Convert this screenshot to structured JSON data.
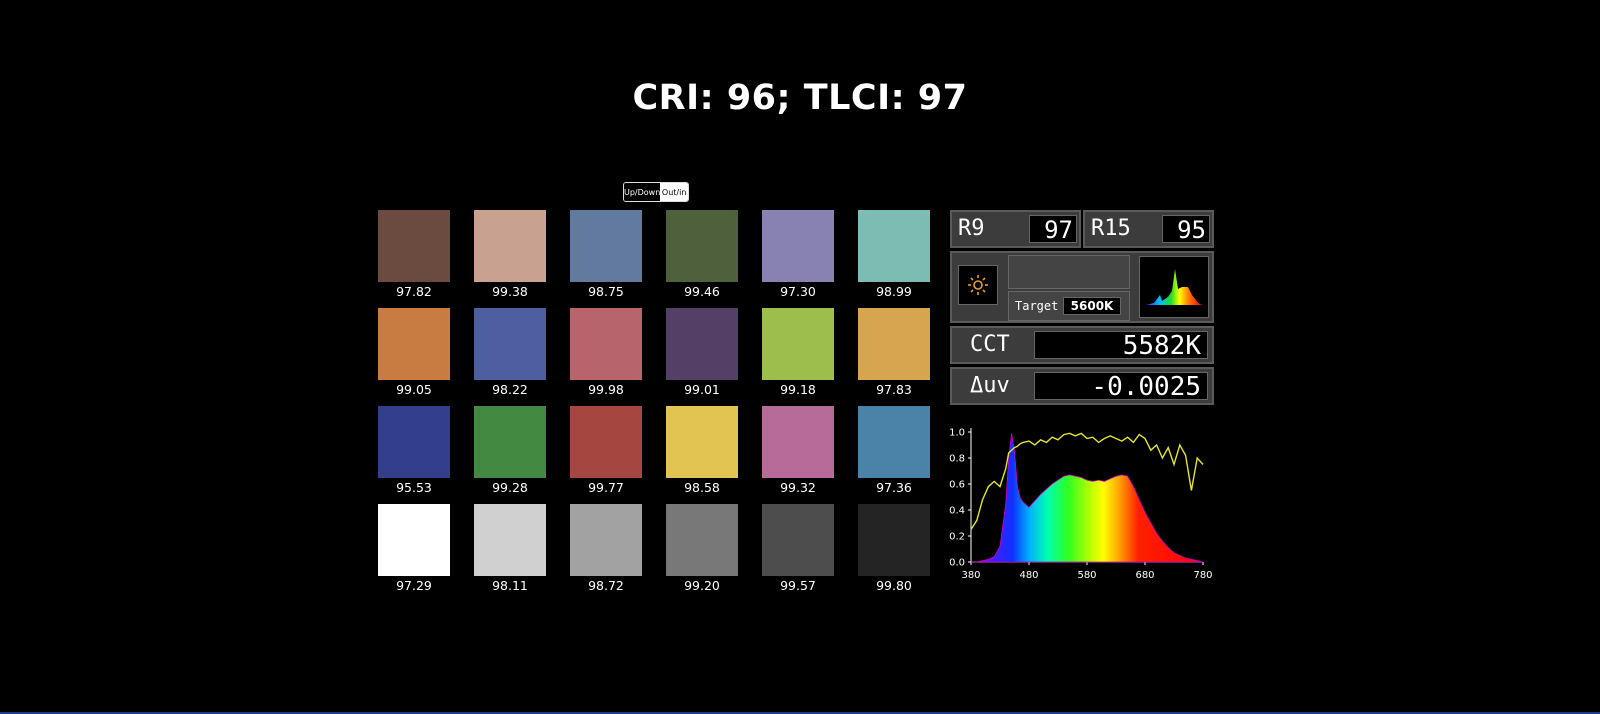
{
  "title": "CRI: 96; TLCI: 97",
  "toggle": {
    "left_label": "Up/Down",
    "right_label": "Out/in"
  },
  "swatches": [
    {
      "color": "#6b4a40",
      "value": "97.82"
    },
    {
      "color": "#c9a190",
      "value": "99.38"
    },
    {
      "color": "#627a9d",
      "value": "98.75"
    },
    {
      "color": "#4f613c",
      "value": "99.46"
    },
    {
      "color": "#8882b2",
      "value": "97.30"
    },
    {
      "color": "#7bbdb2",
      "value": "98.99"
    },
    {
      "color": "#c97c42",
      "value": "99.05"
    },
    {
      "color": "#4d5ea1",
      "value": "98.22"
    },
    {
      "color": "#b8646c",
      "value": "99.98"
    },
    {
      "color": "#543f66",
      "value": "99.01"
    },
    {
      "color": "#9dbd4d",
      "value": "99.18"
    },
    {
      "color": "#d6a550",
      "value": "97.83"
    },
    {
      "color": "#343f8b",
      "value": "95.53"
    },
    {
      "color": "#448941",
      "value": "99.28"
    },
    {
      "color": "#a54640",
      "value": "99.77"
    },
    {
      "color": "#e2c453",
      "value": "98.58"
    },
    {
      "color": "#b66b99",
      "value": "99.32"
    },
    {
      "color": "#4983a8",
      "value": "97.36"
    },
    {
      "color": "#ffffff",
      "value": "97.29"
    },
    {
      "color": "#d0d0d0",
      "value": "98.11"
    },
    {
      "color": "#a2a2a2",
      "value": "98.72"
    },
    {
      "color": "#787878",
      "value": "99.20"
    },
    {
      "color": "#4d4d4d",
      "value": "99.57"
    },
    {
      "color": "#242424",
      "value": "99.80"
    }
  ],
  "meter": {
    "r9_label": "R9",
    "r9_value": "97",
    "r15_label": "R15",
    "r15_value": "95",
    "target_label": "Target",
    "target_value": "5600K",
    "cct_label": "CCT",
    "cct_value": "5582K",
    "duv_label": "Δuv",
    "duv_value": "-0.0025",
    "sun_icon_color": "#e8a020"
  },
  "chart_data": {
    "type": "area",
    "x": [
      380,
      390,
      400,
      410,
      420,
      430,
      440,
      445,
      450,
      455,
      460,
      465,
      470,
      480,
      490,
      500,
      510,
      520,
      530,
      540,
      550,
      560,
      570,
      580,
      590,
      600,
      610,
      620,
      630,
      640,
      650,
      660,
      670,
      680,
      690,
      700,
      710,
      720,
      730,
      740,
      750,
      760,
      770,
      780
    ],
    "series": [
      {
        "values": [
          0.0,
          0.0,
          0.01,
          0.02,
          0.04,
          0.12,
          0.45,
          0.8,
          0.99,
          0.85,
          0.58,
          0.49,
          0.46,
          0.42,
          0.47,
          0.52,
          0.56,
          0.6,
          0.63,
          0.66,
          0.67,
          0.66,
          0.65,
          0.63,
          0.62,
          0.63,
          0.62,
          0.64,
          0.66,
          0.67,
          0.66,
          0.58,
          0.48,
          0.38,
          0.3,
          0.22,
          0.16,
          0.11,
          0.07,
          0.05,
          0.03,
          0.02,
          0.01,
          0.0
        ]
      },
      {
        "values": [
          0.25,
          0.32,
          0.48,
          0.58,
          0.62,
          0.58,
          0.72,
          0.84,
          0.86,
          0.88,
          0.89,
          0.91,
          0.92,
          0.93,
          0.9,
          0.94,
          0.92,
          0.96,
          0.94,
          0.98,
          0.99,
          0.97,
          0.99,
          0.95,
          0.96,
          0.92,
          0.95,
          0.97,
          0.95,
          0.93,
          0.96,
          0.92,
          0.98,
          0.95,
          0.86,
          0.9,
          0.8,
          0.88,
          0.75,
          0.9,
          0.82,
          0.55,
          0.8,
          0.75
        ]
      }
    ],
    "xlim": [
      380,
      780
    ],
    "ylim": [
      0,
      1.0
    ],
    "xticks": [
      "380",
      "480",
      "580",
      "680",
      "780"
    ],
    "yticks": [
      "0.0",
      "0.2",
      "0.4",
      "0.6",
      "0.8",
      "1.0"
    ],
    "fill": "spectral",
    "line_color": "#e5e52a"
  }
}
